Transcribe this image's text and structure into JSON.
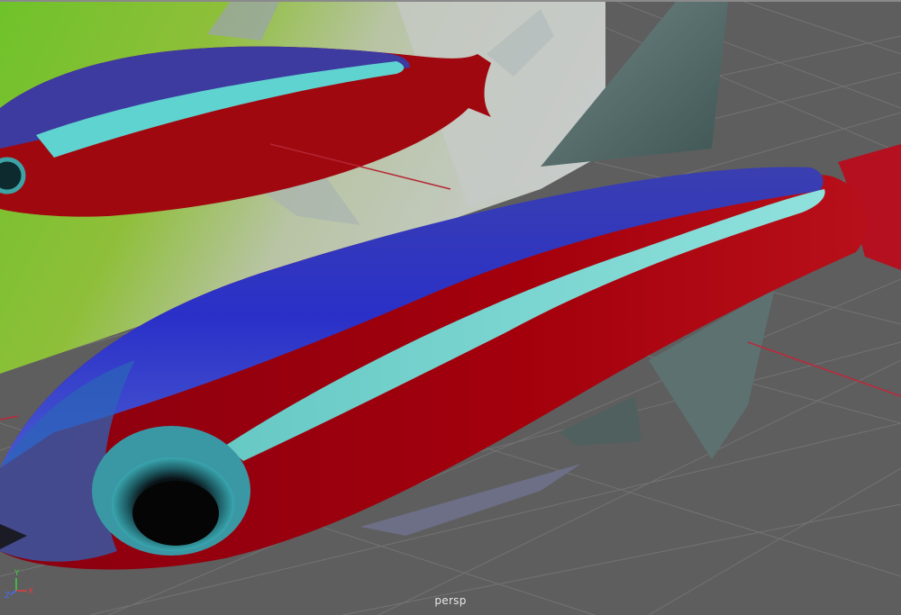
{
  "viewport": {
    "camera_name": "persp"
  },
  "axis_gizmo": {
    "x_label": "X",
    "y_label": "Y",
    "z_label": "Z",
    "x_color": "#e23b3b",
    "y_color": "#3bd23b",
    "z_color": "#4a6bff"
  },
  "scene": {
    "objects": [
      "reference-image-plane",
      "fish-model"
    ],
    "grid_color": "#727272",
    "background_color": "#5e5e5e",
    "axis_line_color": "#c0273a"
  }
}
